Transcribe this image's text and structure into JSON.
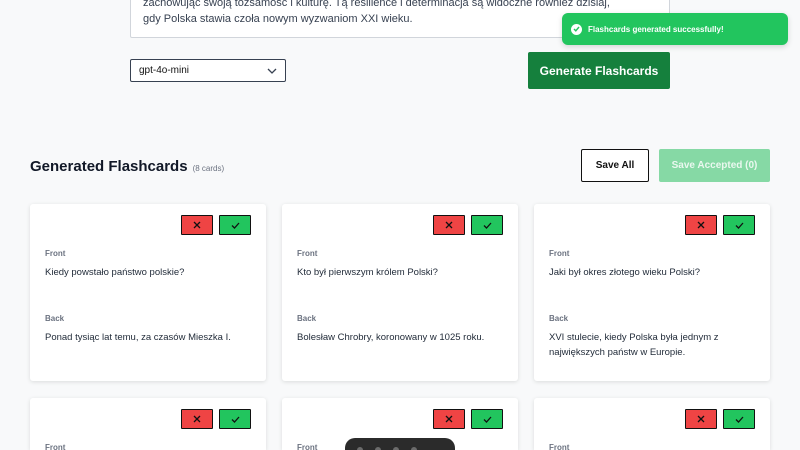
{
  "textarea": {
    "lines": [
      "zachowując swoją tożsamość i kulturę. Tą resilience i determinacja są widoczne również dzisiaj,",
      "gdy Polska stawia czoła nowym wyzwaniom XXI wieku."
    ]
  },
  "model_select": {
    "value": "gpt-4o-mini"
  },
  "generate_button": {
    "label": "Generate Flashcards"
  },
  "toast": {
    "message": "Flashcards generated successfully!",
    "color": "#22c55e"
  },
  "section": {
    "title": "Generated Flashcards",
    "count": "(8 cards)",
    "save_all_label": "Save All",
    "save_accepted_label": "Save Accepted (0)"
  },
  "labels": {
    "front": "Front",
    "back": "Back"
  },
  "cards": [
    {
      "front": "Kiedy powstało państwo polskie?",
      "back": "Ponad tysiąc lat temu, za czasów Mieszka I."
    },
    {
      "front": "Kto był pierwszym królem Polski?",
      "back": "Bolesław Chrobry, koronowany w 1025 roku."
    },
    {
      "front": "Jaki był okres złotego wieku Polski?",
      "back": "XVI stulecie, kiedy Polska była jednym z największych państw w Europie."
    }
  ],
  "colors": {
    "accent": "#15803d",
    "reject": "#ef4444",
    "accept": "#22c55e",
    "disabled": "#86d9a5"
  }
}
